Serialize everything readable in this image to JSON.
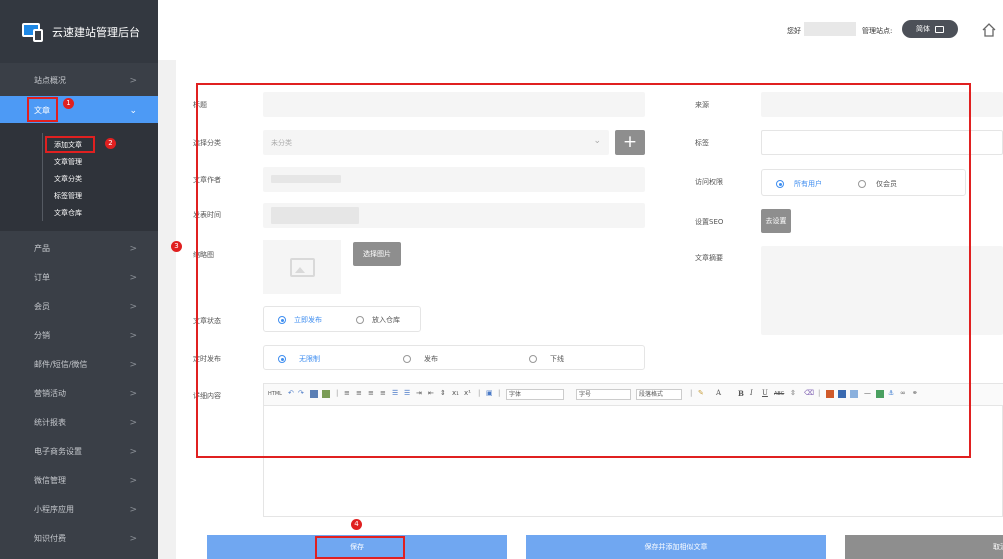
{
  "brand": {
    "title": "云速建站管理后台"
  },
  "topbar": {
    "greeting": "您好",
    "site_label": "管理站点:",
    "lang_pill": "简体"
  },
  "sidebar": {
    "items": [
      {
        "label": "站点概况"
      },
      {
        "label": "文章"
      },
      {
        "label": "产品"
      },
      {
        "label": "订单"
      },
      {
        "label": "会员"
      },
      {
        "label": "分销"
      },
      {
        "label": "邮件/短信/微信"
      },
      {
        "label": "营销活动"
      },
      {
        "label": "统计报表"
      },
      {
        "label": "电子商务设置"
      },
      {
        "label": "微信管理"
      },
      {
        "label": "小程序应用"
      },
      {
        "label": "知识付费"
      }
    ],
    "chevron": ">",
    "subitems": [
      {
        "label": "添加文章"
      },
      {
        "label": "文章管理"
      },
      {
        "label": "文章分类"
      },
      {
        "label": "标签管理"
      },
      {
        "label": "文章仓库"
      }
    ]
  },
  "badges": [
    "1",
    "2",
    "3",
    "4"
  ],
  "form": {
    "title_label": "标题",
    "category_label": "选择分类",
    "category_placeholder": "未分类",
    "plus": "+",
    "author_label": "文章作者",
    "publish_time_label": "发表时间",
    "thumbnail_label": "缩略图",
    "choose_image": "选择图片",
    "status_label": "文章状态",
    "status_publish": "立即发布",
    "status_warehouse": "放入仓库",
    "scheduled_label": "定时发布",
    "sched_unlimited": "无限制",
    "sched_publish": "发布",
    "sched_offline": "下线",
    "detail_label": "详细内容",
    "source_label": "来源",
    "tags_label": "标签",
    "access_label": "访问权限",
    "access_all": "所有用户",
    "access_members": "仅会员",
    "seo_label": "设置SEO",
    "seo_button": "去设置",
    "summary_label": "文章摘要"
  },
  "editor": {
    "font_family": "字体",
    "font_size": "字号",
    "paragraph": "段落格式",
    "text_b": "B",
    "text_i": "I",
    "text_u": "U",
    "text_a": "A"
  },
  "actions": {
    "save": "保存",
    "save_add_similar": "保存并添加相似文章",
    "cancel": "取消"
  },
  "colors": {
    "accent": "#4d9af5",
    "highlight": "#e02020",
    "sidebar_bg": "#3a3f47"
  }
}
